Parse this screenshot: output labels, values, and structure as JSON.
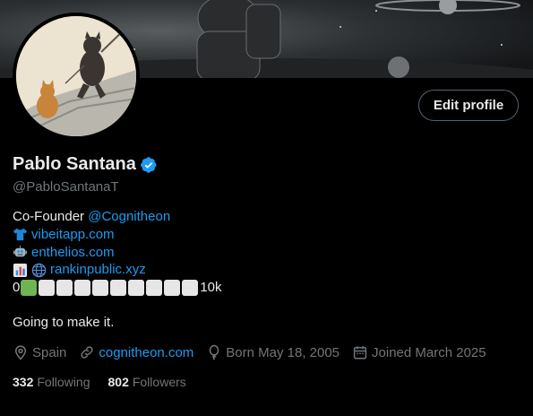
{
  "header": {
    "edit_profile_label": "Edit profile"
  },
  "profile": {
    "name": "Pablo Santana",
    "handle": "@PabloSantanaT",
    "bio": {
      "cofounder_prefix": "Co-Founder ",
      "cofounder_mention": "@Cognitheon",
      "link_1": {
        "icon": "tshirt-emoji",
        "text": "vibeitapp.com"
      },
      "link_2": {
        "icon": "robot-emoji",
        "text": "enthelios.com"
      },
      "link_3": {
        "icons": [
          "bar-chart-emoji",
          "globe-emoji"
        ],
        "text": "rankinpublic.xyz"
      },
      "progress": {
        "start_label": "0",
        "end_label": "10k",
        "filled": 1,
        "total": 10
      },
      "tagline": "Going to make it."
    },
    "meta": {
      "location": "Spain",
      "website": "cognitheon.com",
      "born": "Born May 18, 2005",
      "joined": "Joined March 2025"
    },
    "stats": {
      "following_count": "332",
      "following_label": "Following",
      "followers_count": "802",
      "followers_label": "Followers"
    }
  },
  "colors": {
    "accent": "#1d9bf0",
    "background": "#000000",
    "muted": "#71767b",
    "progress_fill": "#6fb553"
  }
}
